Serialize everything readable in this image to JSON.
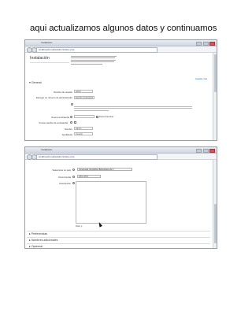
{
  "heading": "aqui actualizamos algunos datos y continuamos",
  "screenshot1": {
    "browser": {
      "tab_title": "Instalacion",
      "url": "localhost/moodle/admin/index.php"
    },
    "page_title": "Instalación",
    "settings_link": "Guardar más",
    "section_general": "General",
    "fields": [
      {
        "label": "Nombre de usuario",
        "value": "admin"
      },
      {
        "label": "Escoger un número de administrador",
        "value": "Escribe contraseña"
      },
      {
        "label": "Nueva contraseña",
        "value": "",
        "extra": "Desenmascarar"
      },
      {
        "label": "Forzar cambio de contraseña",
        "value": ""
      },
      {
        "label": "Nombre",
        "value": "Admin"
      },
      {
        "label": "Apellido(s)",
        "value": "Usuario"
      }
    ]
  },
  "screenshot2": {
    "browser": {
      "tab_title": "Instalacion",
      "url": "localhost/moodle/admin/index.php"
    },
    "fields": [
      {
        "label": "Seleccione su país",
        "value": "Venezuela, República Bolivariana de"
      },
      {
        "label": "Zona horaria",
        "value": "UTC-4,5"
      },
      {
        "label": "Descripción",
        "value": ""
      }
    ],
    "editor_path": "Ruta: p",
    "sections": [
      "Preferencias",
      "Nombres adicionales",
      "Opcional"
    ]
  }
}
